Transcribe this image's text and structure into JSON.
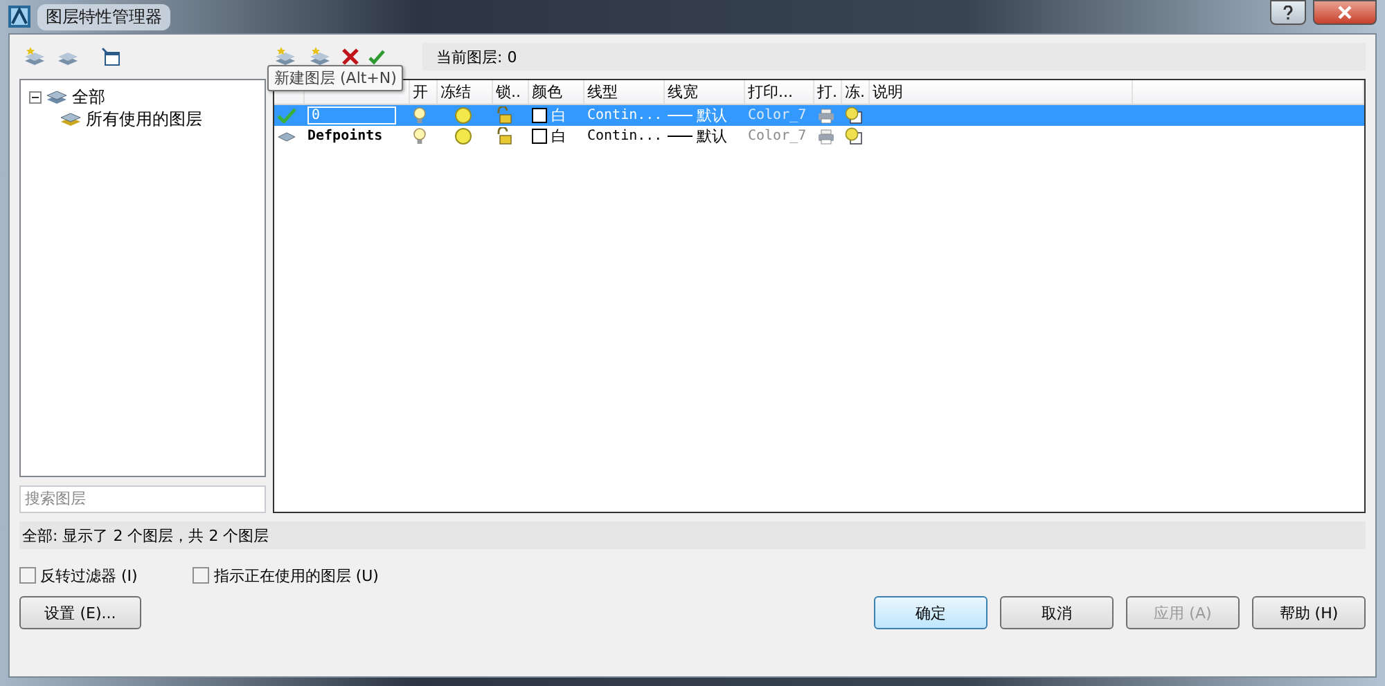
{
  "window": {
    "title": "图层特性管理器"
  },
  "tree": {
    "label": "全部",
    "expanded": true,
    "children": [
      {
        "label": "所有使用的图层"
      }
    ]
  },
  "search": {
    "placeholder": "搜索图层"
  },
  "current_layer": "当前图层: 0",
  "tooltip": "新建图层 (Alt+N)",
  "columns": [
    "开",
    "冻结",
    "锁..",
    "颜色",
    "线型",
    "线宽",
    "打印...",
    "打.",
    "冻.",
    "说明"
  ],
  "rows": [
    {
      "current": true,
      "selected": true,
      "name": "0",
      "on": true,
      "frozen": false,
      "locked": false,
      "color": "#ffffff",
      "color_name": "白",
      "linetype": "Contin...",
      "lineweight": "默认",
      "plot_style": "Color_7",
      "plot": true
    },
    {
      "current": false,
      "selected": false,
      "name": "Defpoints",
      "on": true,
      "frozen": false,
      "locked": false,
      "color": "#ffffff",
      "color_name": "白",
      "linetype": "Contin...",
      "lineweight": "默认",
      "plot_style": "Color_7",
      "plot": true
    }
  ],
  "status": "全部: 显示了 2 个图层，共 2 个图层",
  "checkboxes": [
    {
      "label": "反转过滤器 (I)",
      "checked": false
    },
    {
      "label": "指示正在使用的图层 (U)",
      "checked": false
    }
  ],
  "settings_button": "设置 (E)...",
  "buttons": [
    {
      "label": "确定",
      "default": true,
      "disabled": false
    },
    {
      "label": "取消",
      "default": false,
      "disabled": false
    },
    {
      "label": "应用 (A)",
      "default": false,
      "disabled": true
    },
    {
      "label": "帮助 (H)",
      "default": false,
      "disabled": false
    }
  ]
}
